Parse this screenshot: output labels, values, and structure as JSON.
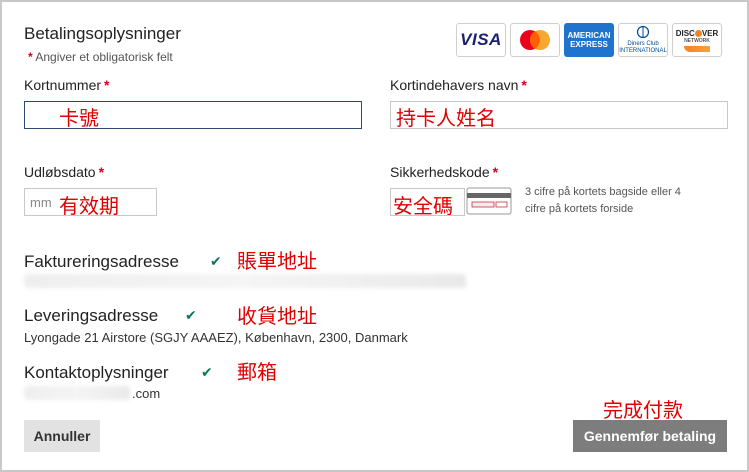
{
  "header": {
    "title": "Betalingsoplysninger",
    "required_star": "*",
    "required_note": "Angiver et obligatorisk felt"
  },
  "card_logos": {
    "visa": "VISA",
    "amex_line1": "AMERICAN",
    "amex_line2": "EXPRESS",
    "diners_line1": "Diners Club",
    "diners_line2": "INTERNATIONAL",
    "discover_line1": "DISC",
    "discover_line2": "VER",
    "discover_line3": "NETWORK"
  },
  "fields": {
    "card_number": {
      "label": "Kortnummer",
      "star": "*",
      "overlay": "卡號"
    },
    "card_holder": {
      "label": "Kortindehavers navn",
      "star": "*",
      "overlay": "持卡人姓名"
    },
    "expiry": {
      "label": "Udløbsdato",
      "star": "*",
      "placeholder": "mm",
      "overlay": "有效期"
    },
    "cvv": {
      "label": "Sikkerhedskode",
      "star": "*",
      "overlay": "安全碼",
      "hint_line1": "3 cifre på kortets bagside eller 4",
      "hint_line2": "cifre på kortets forside"
    }
  },
  "sections": {
    "billing": {
      "title": "Faktureringsadresse",
      "check": "✔",
      "overlay": "賬單地址"
    },
    "shipping": {
      "title": "Leveringsadresse",
      "check": "✔",
      "overlay": "收貨地址",
      "address": "Lyongade 21 Airstore (SGJY AAAEZ), København, 2300, Danmark"
    },
    "contact": {
      "title": "Kontaktoplysninger",
      "check": "✔",
      "overlay": "郵箱",
      "email_suffix": ".com"
    }
  },
  "footer": {
    "cancel_label": "Annuller",
    "pay_label": "Gennemfør betaling",
    "pay_overlay": "完成付款"
  },
  "colors": {
    "accent_check": "#0a7a5c",
    "required_star": "#d0021b",
    "overlay_annotation": "#e00000",
    "pay_button": "#7d7d7d"
  }
}
